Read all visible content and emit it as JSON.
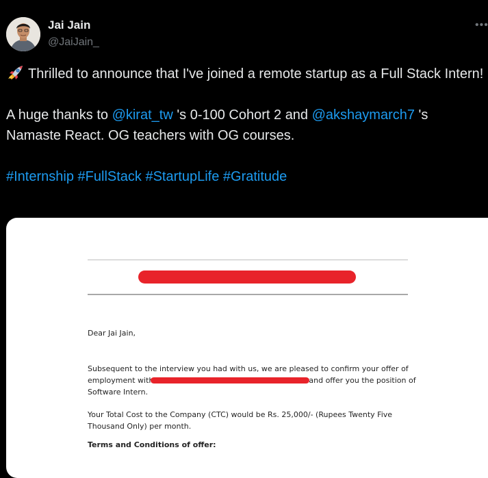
{
  "author": {
    "name": "Jai Jain",
    "handle": "@JaiJain_"
  },
  "more_icon": "•••",
  "tweet": {
    "line1_emoji": "rocket-icon",
    "line1": "Thrilled to announce that I've joined a remote startup as a Full Stack Intern!",
    "line2_prefix": "A huge thanks to ",
    "mention1": "@kirat_tw",
    "line2_mid": " 's 0-100 Cohort 2 and ",
    "mention2": "@akshaymarch7",
    "line2_suffix": " 's Namaste React. OG teachers with OG courses.",
    "hashtags": [
      "#Internship",
      "#FullStack",
      "#StartupLife",
      "#Gratitude"
    ]
  },
  "letter": {
    "greeting": "Dear Jai Jain,",
    "para1_a": "Subsequent to the interview you had with us, we are pleased to confirm your offer of employment with",
    "para1_b": "and offer you the position of Software Intern.",
    "para2": "Your Total Cost to the Company (CTC) would be Rs. 25,000/- (Rupees Twenty Five Thousand Only) per month.",
    "terms_heading": "Terms and Conditions of offer:"
  },
  "colors": {
    "background": "#000000",
    "text": "#e7e9ea",
    "muted": "#71767b",
    "link": "#1d9bf0",
    "redaction": "#e8232a"
  }
}
